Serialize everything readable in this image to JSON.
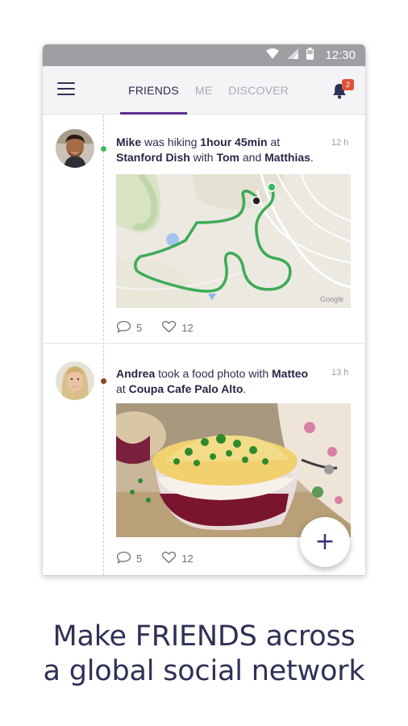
{
  "status_bar": {
    "time": "12:30"
  },
  "app_bar": {
    "tabs": [
      {
        "label": "FRIENDS",
        "active": true
      },
      {
        "label": "ME",
        "active": false
      },
      {
        "label": "DISCOVER",
        "active": false
      }
    ],
    "notification_count": "2"
  },
  "feed": {
    "posts": [
      {
        "user": "Mike",
        "text_1": " was hiking ",
        "duration": "1hour 45min",
        "text_2": " at ",
        "place": "Stanford Dish",
        "text_3": " with ",
        "friend_1": "Tom",
        "text_4": " and ",
        "friend_2": "Matthias",
        "text_5": ".",
        "time": "12 h",
        "comments": "5",
        "likes": "12",
        "dot_color": "#3dbb61",
        "map_watermark": "Google"
      },
      {
        "user": "Andrea",
        "text_1": " took a food photo with ",
        "friend_1": "Matteo",
        "text_2": " at ",
        "place": "Coupa Cafe Palo Alto",
        "text_3": ".",
        "time": "13 h",
        "comments": "5",
        "likes": "12",
        "dot_color": "#8a4a22"
      }
    ]
  },
  "fab": {
    "label": "+"
  },
  "caption": {
    "line_1": "Make FRIENDS across",
    "line_2": "a global social network"
  },
  "colors": {
    "accent": "#5b2e8f",
    "route": "#3dab57",
    "badge": "#e0533a",
    "status_bar": "#9e9ea3"
  }
}
